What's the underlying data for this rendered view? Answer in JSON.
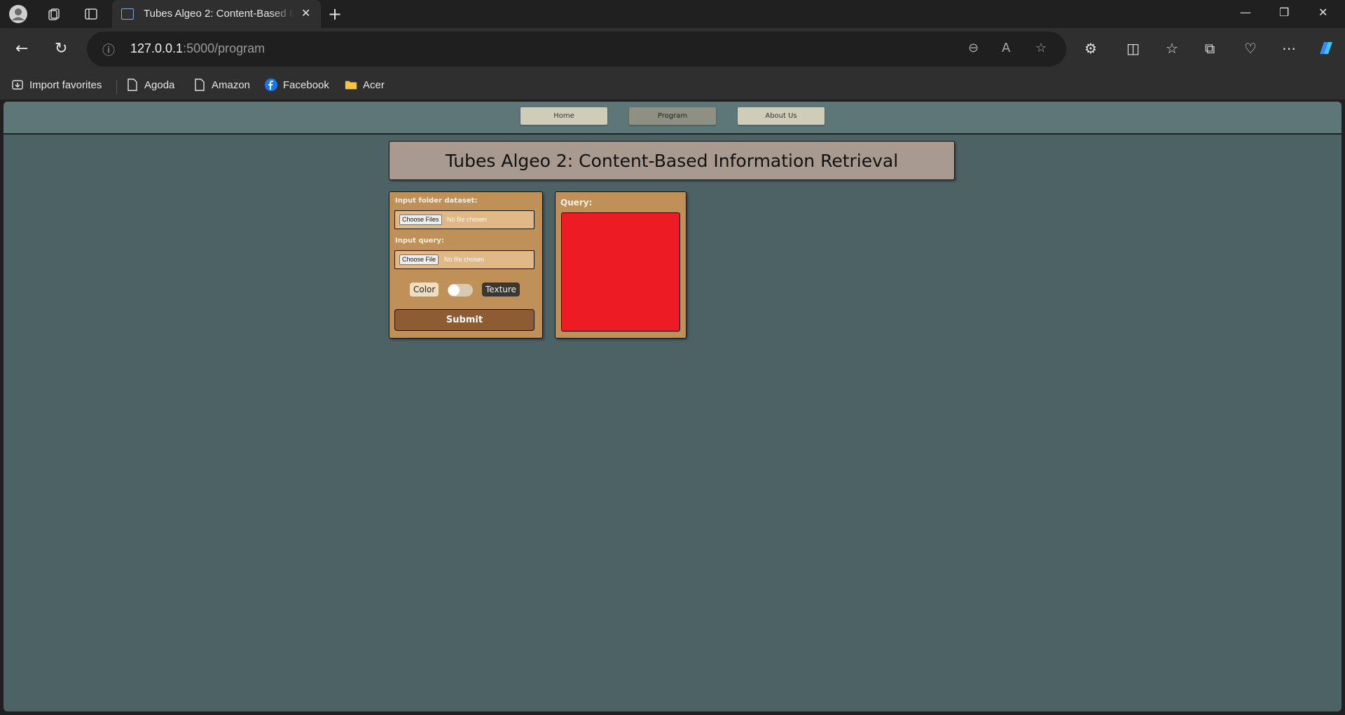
{
  "browser": {
    "tab_title": "Tubes Algeo 2: Content-Based Information Retrieval",
    "url_host": "127.0.0.1",
    "url_path": ":5000/program",
    "bookmarks": [
      {
        "label": "Import favorites",
        "icon": "import-icon"
      },
      {
        "label": "Agoda",
        "icon": "page-icon"
      },
      {
        "label": "Amazon",
        "icon": "page-icon"
      },
      {
        "label": "Facebook",
        "icon": "facebook-icon"
      },
      {
        "label": "Acer",
        "icon": "folder-icon"
      }
    ]
  },
  "site": {
    "nav": {
      "home": "Home",
      "program": "Program",
      "about": "About Us"
    },
    "title": "Tubes Algeo 2: Content-Based Information Retrieval",
    "form": {
      "dataset_label": "Input folder dataset:",
      "dataset_button": "Choose Files",
      "dataset_status": "No file chosen",
      "query_label": "Input query:",
      "query_button": "Choose File",
      "query_status": "No file chosen",
      "toggle_left": "Color",
      "toggle_right": "Texture",
      "submit": "Submit"
    },
    "query_panel": {
      "label": "Query:",
      "image_color": "#ed1c24"
    }
  }
}
